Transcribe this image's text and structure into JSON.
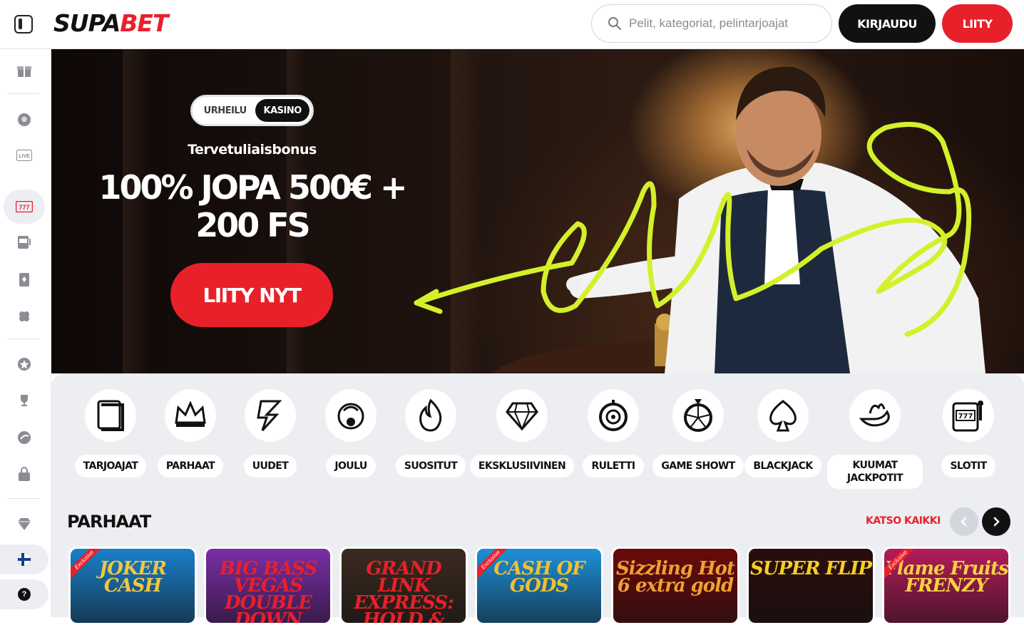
{
  "header": {
    "logo_part1": "SUPA",
    "logo_part2": "BET",
    "search_placeholder": "Pelit, kategoriat, pelintarjoajat",
    "login_label": "KIRJAUDU",
    "join_label": "LIITY"
  },
  "sidebar": {
    "items": [
      {
        "icon": "gift-icon"
      },
      {
        "icon": "soccer-ball-icon"
      },
      {
        "icon": "live-icon",
        "text": "LIVE"
      },
      {
        "icon": "slot-777-icon",
        "text": "777",
        "active": true
      },
      {
        "icon": "slot-machine-icon"
      },
      {
        "icon": "playing-card-icon"
      },
      {
        "icon": "clover-icon"
      },
      {
        "icon": "star-badge-icon"
      },
      {
        "icon": "trophy-icon"
      },
      {
        "icon": "promo-icon"
      },
      {
        "icon": "shop-icon"
      },
      {
        "icon": "diamond-icon"
      }
    ],
    "language_icon": "finland-flag-icon",
    "help_label": "?"
  },
  "hero": {
    "toggle_off": "URHEILU",
    "toggle_on": "KASINO",
    "welcome": "Tervetuliaisbonus",
    "bonus_line1": "100% JOPA 500€ +",
    "bonus_line2": "200 FS",
    "cta_label": "LIITY NYT",
    "accent_color": "#d4f02b"
  },
  "categories": [
    {
      "label": "TARJOAJAT",
      "icon": "book-icon"
    },
    {
      "label": "PARHAAT",
      "icon": "crown-icon"
    },
    {
      "label": "UUDET",
      "icon": "lightning-icon"
    },
    {
      "label": "JOULU",
      "icon": "christmas-icon"
    },
    {
      "label": "SUOSITUT",
      "icon": "flame-icon"
    },
    {
      "label": "EKSKLUSIIVINEN",
      "icon": "diamond-icon"
    },
    {
      "label": "RULETTI",
      "icon": "roulette-icon"
    },
    {
      "label": "GAME SHOWT",
      "icon": "wheel-icon"
    },
    {
      "label": "BLACKJACK",
      "icon": "spade-icon"
    },
    {
      "label": "KUUMAT JACKPOTIT",
      "icon": "chili-icon"
    },
    {
      "label": "SLOTIT",
      "icon": "slot-machine-icon"
    }
  ],
  "section": {
    "title": "PARHAAT",
    "see_all": "KATSO KAIKKI"
  },
  "games": [
    {
      "title": "JOKER CASH",
      "exclusive_label": "Exclusive",
      "bg": "#1a7fc9",
      "color": "#f3c640"
    },
    {
      "title": "BIG BASS VEGAS DOUBLE DOWN DELUXE",
      "bg": "#7b2ea8",
      "color": "#e8202a"
    },
    {
      "title": "GRAND LINK EXPRESS: HOLD & WIN",
      "bg": "#3a2a20",
      "color": "#e8202a"
    },
    {
      "title": "CASH OF GODS",
      "exclusive_label": "Exclusive",
      "bg": "#1e8fd8",
      "color": "#f0c030"
    },
    {
      "title": "Sizzling Hot 6 extra gold",
      "bg": "#6a0a0a",
      "color": "#f0a030"
    },
    {
      "title": "SUPER FLIP",
      "bg": "#2a0d0d",
      "color": "#f5d020"
    },
    {
      "title": "Flame Fruits FRENZY",
      "exclusive_label": "Exclusive",
      "bg": "#b21c5a",
      "color": "#f7d240"
    }
  ]
}
